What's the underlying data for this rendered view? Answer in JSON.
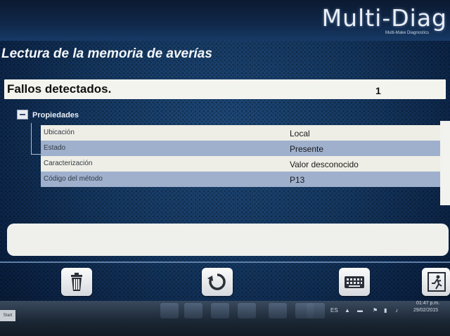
{
  "brand": {
    "name": "Multi-Diag",
    "subtitle": "Multi-Make Diagnostics"
  },
  "page": {
    "title": "Lectura de la memoria de averías"
  },
  "faults": {
    "label": "Fallos detectados.",
    "count": "1"
  },
  "properties": {
    "title": "Propiedades",
    "rows": [
      {
        "key": "Ubicación",
        "value": "Local"
      },
      {
        "key": "Estado",
        "value": "Presente"
      },
      {
        "key": "Caracterización",
        "value": "Valor desconocido"
      },
      {
        "key": "Código del método",
        "value": "P13"
      }
    ]
  },
  "toolbar": {
    "icons": [
      "trash-icon",
      "refresh-icon",
      "keyboard-icon",
      "exit-icon"
    ]
  },
  "taskbar": {
    "start_label": "Start",
    "tray_lang": "ES",
    "time": "01:47 p.m.",
    "date": "29/02/2015"
  },
  "colors": {
    "row_light": "#eeeee6",
    "row_blue": "#9fb0cd",
    "background": "#153861"
  }
}
